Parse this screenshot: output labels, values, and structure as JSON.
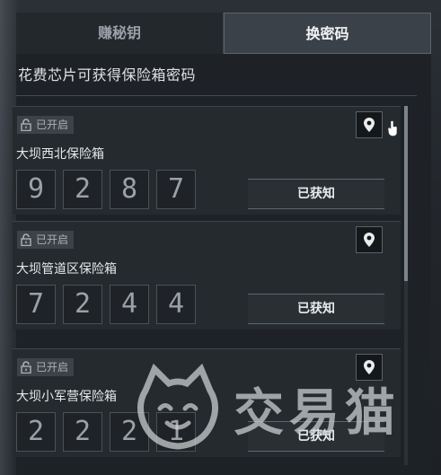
{
  "tabs": [
    {
      "label": "赚秘钥",
      "active": false
    },
    {
      "label": "换密码",
      "active": true
    }
  ],
  "subtitle": "花费芯片可获得保险箱密码",
  "safes": [
    {
      "status": "已开启",
      "name": "大坝西北保险箱",
      "digits": [
        "9",
        "2",
        "8",
        "7"
      ],
      "action_label": "已获知"
    },
    {
      "status": "已开启",
      "name": "大坝管道区保险箱",
      "digits": [
        "7",
        "2",
        "4",
        "4"
      ],
      "action_label": "已获知"
    },
    {
      "status": "已开启",
      "name": "大坝小军营保险箱",
      "digits": [
        "2",
        "2",
        "2",
        "1"
      ],
      "action_label": "已获知"
    }
  ],
  "watermark": {
    "text": "交易猫"
  },
  "icons": {
    "location": "location-pin-icon",
    "lock": "unlock-icon"
  },
  "colors": {
    "panel": "#1e2226",
    "active_tab": "#3a4149",
    "badge": "#3c4248"
  },
  "scroll_position": 0
}
